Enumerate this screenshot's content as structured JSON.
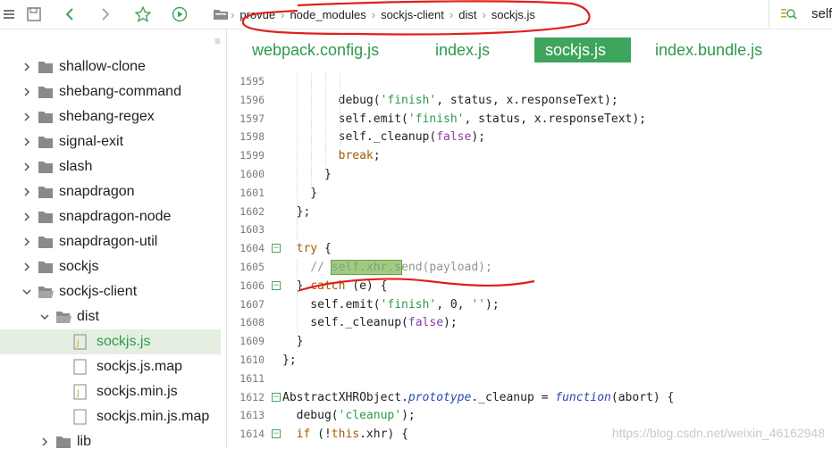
{
  "toolbar": {
    "breadcrumb": [
      "provue",
      "node_modules",
      "sockjs-client",
      "dist",
      "sockjs.js"
    ],
    "search_text": "self"
  },
  "sidebar": {
    "items": [
      {
        "label": "shallow-clone",
        "kind": "folder",
        "level": 0,
        "state": "collapsed"
      },
      {
        "label": "shebang-command",
        "kind": "folder",
        "level": 0,
        "state": "collapsed"
      },
      {
        "label": "shebang-regex",
        "kind": "folder",
        "level": 0,
        "state": "collapsed"
      },
      {
        "label": "signal-exit",
        "kind": "folder",
        "level": 0,
        "state": "collapsed"
      },
      {
        "label": "slash",
        "kind": "folder",
        "level": 0,
        "state": "collapsed"
      },
      {
        "label": "snapdragon",
        "kind": "folder",
        "level": 0,
        "state": "collapsed"
      },
      {
        "label": "snapdragon-node",
        "kind": "folder",
        "level": 0,
        "state": "collapsed"
      },
      {
        "label": "snapdragon-util",
        "kind": "folder",
        "level": 0,
        "state": "collapsed"
      },
      {
        "label": "sockjs",
        "kind": "folder",
        "level": 0,
        "state": "collapsed"
      },
      {
        "label": "sockjs-client",
        "kind": "folder",
        "level": 0,
        "state": "expanded"
      },
      {
        "label": "dist",
        "kind": "folder",
        "level": 1,
        "state": "expanded"
      },
      {
        "label": "sockjs.js",
        "kind": "js-file",
        "level": 2,
        "state": "selected"
      },
      {
        "label": "sockjs.js.map",
        "kind": "file",
        "level": 2,
        "state": ""
      },
      {
        "label": "sockjs.min.js",
        "kind": "js-file",
        "level": 2,
        "state": ""
      },
      {
        "label": "sockjs.min.js.map",
        "kind": "file",
        "level": 2,
        "state": ""
      },
      {
        "label": "lib",
        "kind": "folder",
        "level": 1,
        "state": "collapsed"
      }
    ]
  },
  "tabs": [
    {
      "label": "webpack.config.js",
      "active": false
    },
    {
      "label": "index.js",
      "active": false
    },
    {
      "label": "sockjs.js",
      "active": true
    },
    {
      "label": "index.bundle.js",
      "active": false
    }
  ],
  "code": {
    "lines": [
      {
        "n": "1595",
        "text": ""
      },
      {
        "n": "1596",
        "text": "        debug('finish', status, x.responseText);"
      },
      {
        "n": "1597",
        "text": "        self.emit('finish', status, x.responseText);"
      },
      {
        "n": "1598",
        "text": "        self._cleanup(false);"
      },
      {
        "n": "1599",
        "text": "        break;"
      },
      {
        "n": "1600",
        "text": "      }"
      },
      {
        "n": "1601",
        "text": "    }"
      },
      {
        "n": "1602",
        "text": "  };"
      },
      {
        "n": "1603",
        "text": ""
      },
      {
        "n": "1604",
        "text": "  try {",
        "fold": "−"
      },
      {
        "n": "1605",
        "text": "    // self.xhr.send(payload);"
      },
      {
        "n": "1606",
        "text": "  } catch (e) {",
        "fold": "−"
      },
      {
        "n": "1607",
        "text": "    self.emit('finish', 0, '');"
      },
      {
        "n": "1608",
        "text": "    self._cleanup(false);"
      },
      {
        "n": "1609",
        "text": "  }"
      },
      {
        "n": "1610",
        "text": "};"
      },
      {
        "n": "1611",
        "text": ""
      },
      {
        "n": "1612",
        "text": "AbstractXHRObject.prototype._cleanup = function(abort) {",
        "fold": "−"
      },
      {
        "n": "1613",
        "text": "  debug('cleanup');"
      },
      {
        "n": "1614",
        "text": "  if (!this.xhr) {",
        "fold": "−"
      }
    ]
  },
  "watermark": "https://blog.csdn.net/weixin_46162948",
  "colors": {
    "accent": "#3ea55c",
    "annotation": "#e0201b"
  }
}
